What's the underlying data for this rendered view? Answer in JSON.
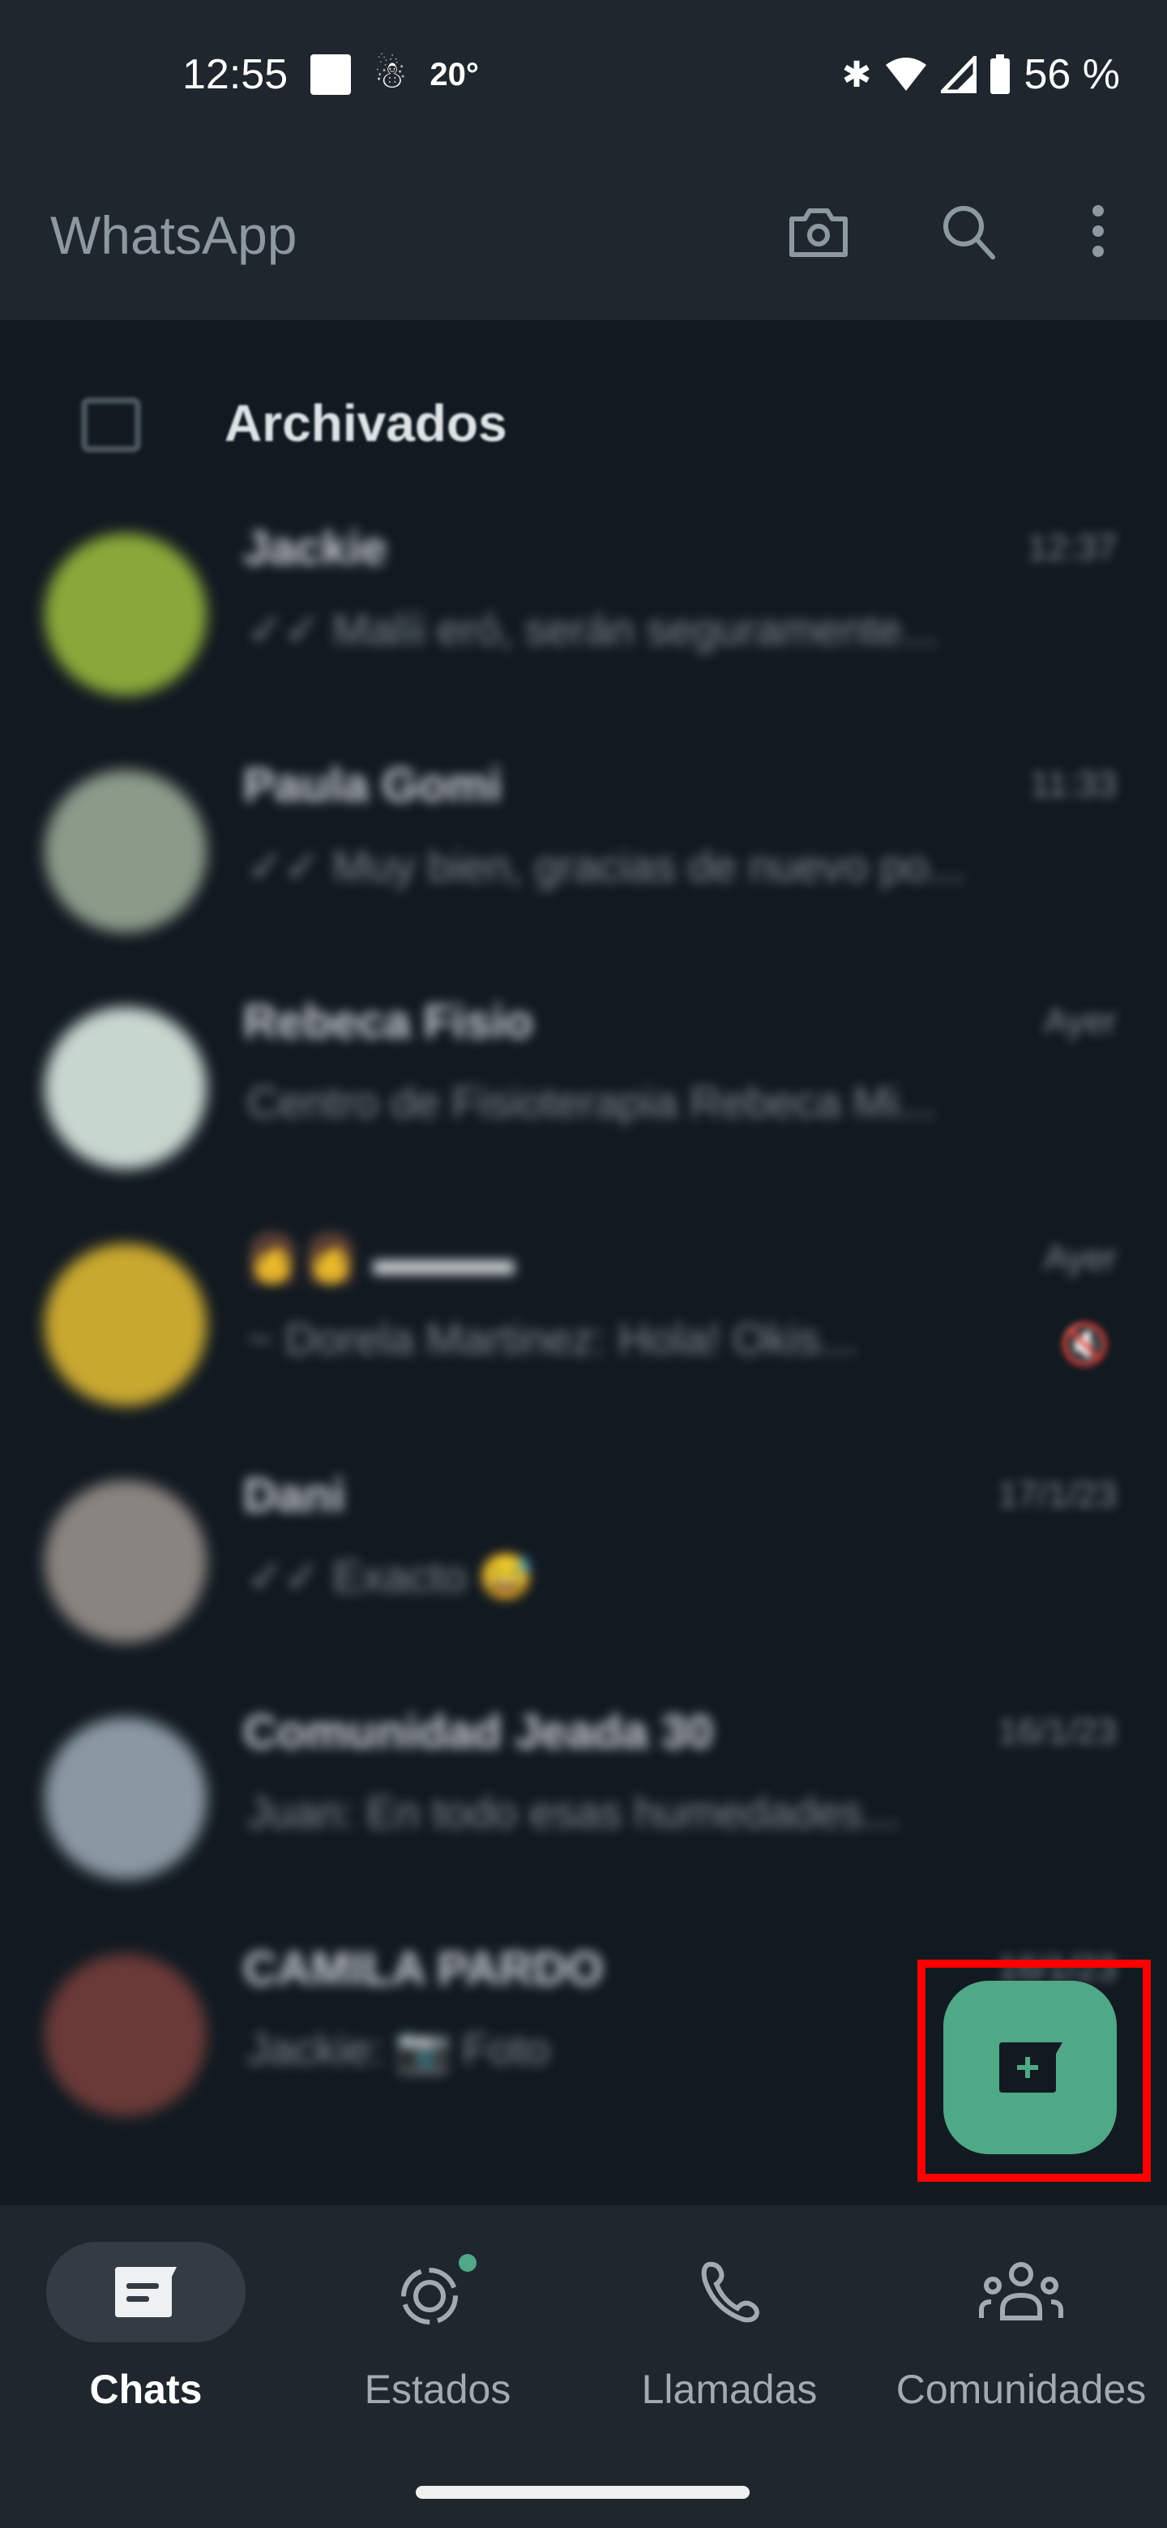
{
  "status_bar": {
    "time": "12:55",
    "temperature": "20°",
    "battery": "56 %",
    "icons": [
      "notification-square-icon",
      "weather-icon",
      "bluetooth-icon",
      "wifi-icon",
      "signal-icon",
      "battery-icon"
    ]
  },
  "header": {
    "title": "WhatsApp",
    "actions": [
      "camera-icon",
      "search-icon",
      "more-vert-icon"
    ]
  },
  "archived": {
    "label": "Archivados"
  },
  "chats": [
    {
      "name": "Jackie",
      "message": "✓✓ Malíi eró, serán seguramente...",
      "time": "12:37",
      "avatar_color": "#8aa83a"
    },
    {
      "name": "Paula Gomi",
      "message": "✓✓ Muy bien, gracias de nuevo po...",
      "time": "11:33",
      "avatar_color": "#8c9a8a"
    },
    {
      "name": "Rebeca Fisio",
      "message": "Centro de Fisioterapia Rebeca Mi...",
      "time": "Ayer",
      "avatar_color": "#c8d6d0"
    },
    {
      "name": "👩👩 ▬▬▬",
      "message": "~ Dorela Martinez: Hola! Okis...",
      "time": "Ayer",
      "muted": true,
      "avatar_color": "#c9a830"
    },
    {
      "name": "Dani",
      "message": "✓✓ Exacto 😅",
      "time": "17/1/23",
      "avatar_color": "#8a8480"
    },
    {
      "name": "Comunidad Jeada 30",
      "message": "Juan: En todo esas humedades...",
      "time": "16/1/23",
      "avatar_color": "#8a98a2"
    },
    {
      "name": "CAMILA PARDO",
      "message": "Jackie: 📷 Foto",
      "time": "16/1/23",
      "avatar_color": "#6a3a38"
    }
  ],
  "fab": {
    "icon": "new-chat-icon",
    "highlight_color": "#ff0000",
    "color": "#4fa886"
  },
  "bottom_nav": [
    {
      "label": "Chats",
      "icon": "chats-icon",
      "active": true
    },
    {
      "label": "Estados",
      "icon": "status-icon",
      "badge": true
    },
    {
      "label": "Llamadas",
      "icon": "phone-icon"
    },
    {
      "label": "Comunidades",
      "icon": "communities-icon"
    }
  ]
}
